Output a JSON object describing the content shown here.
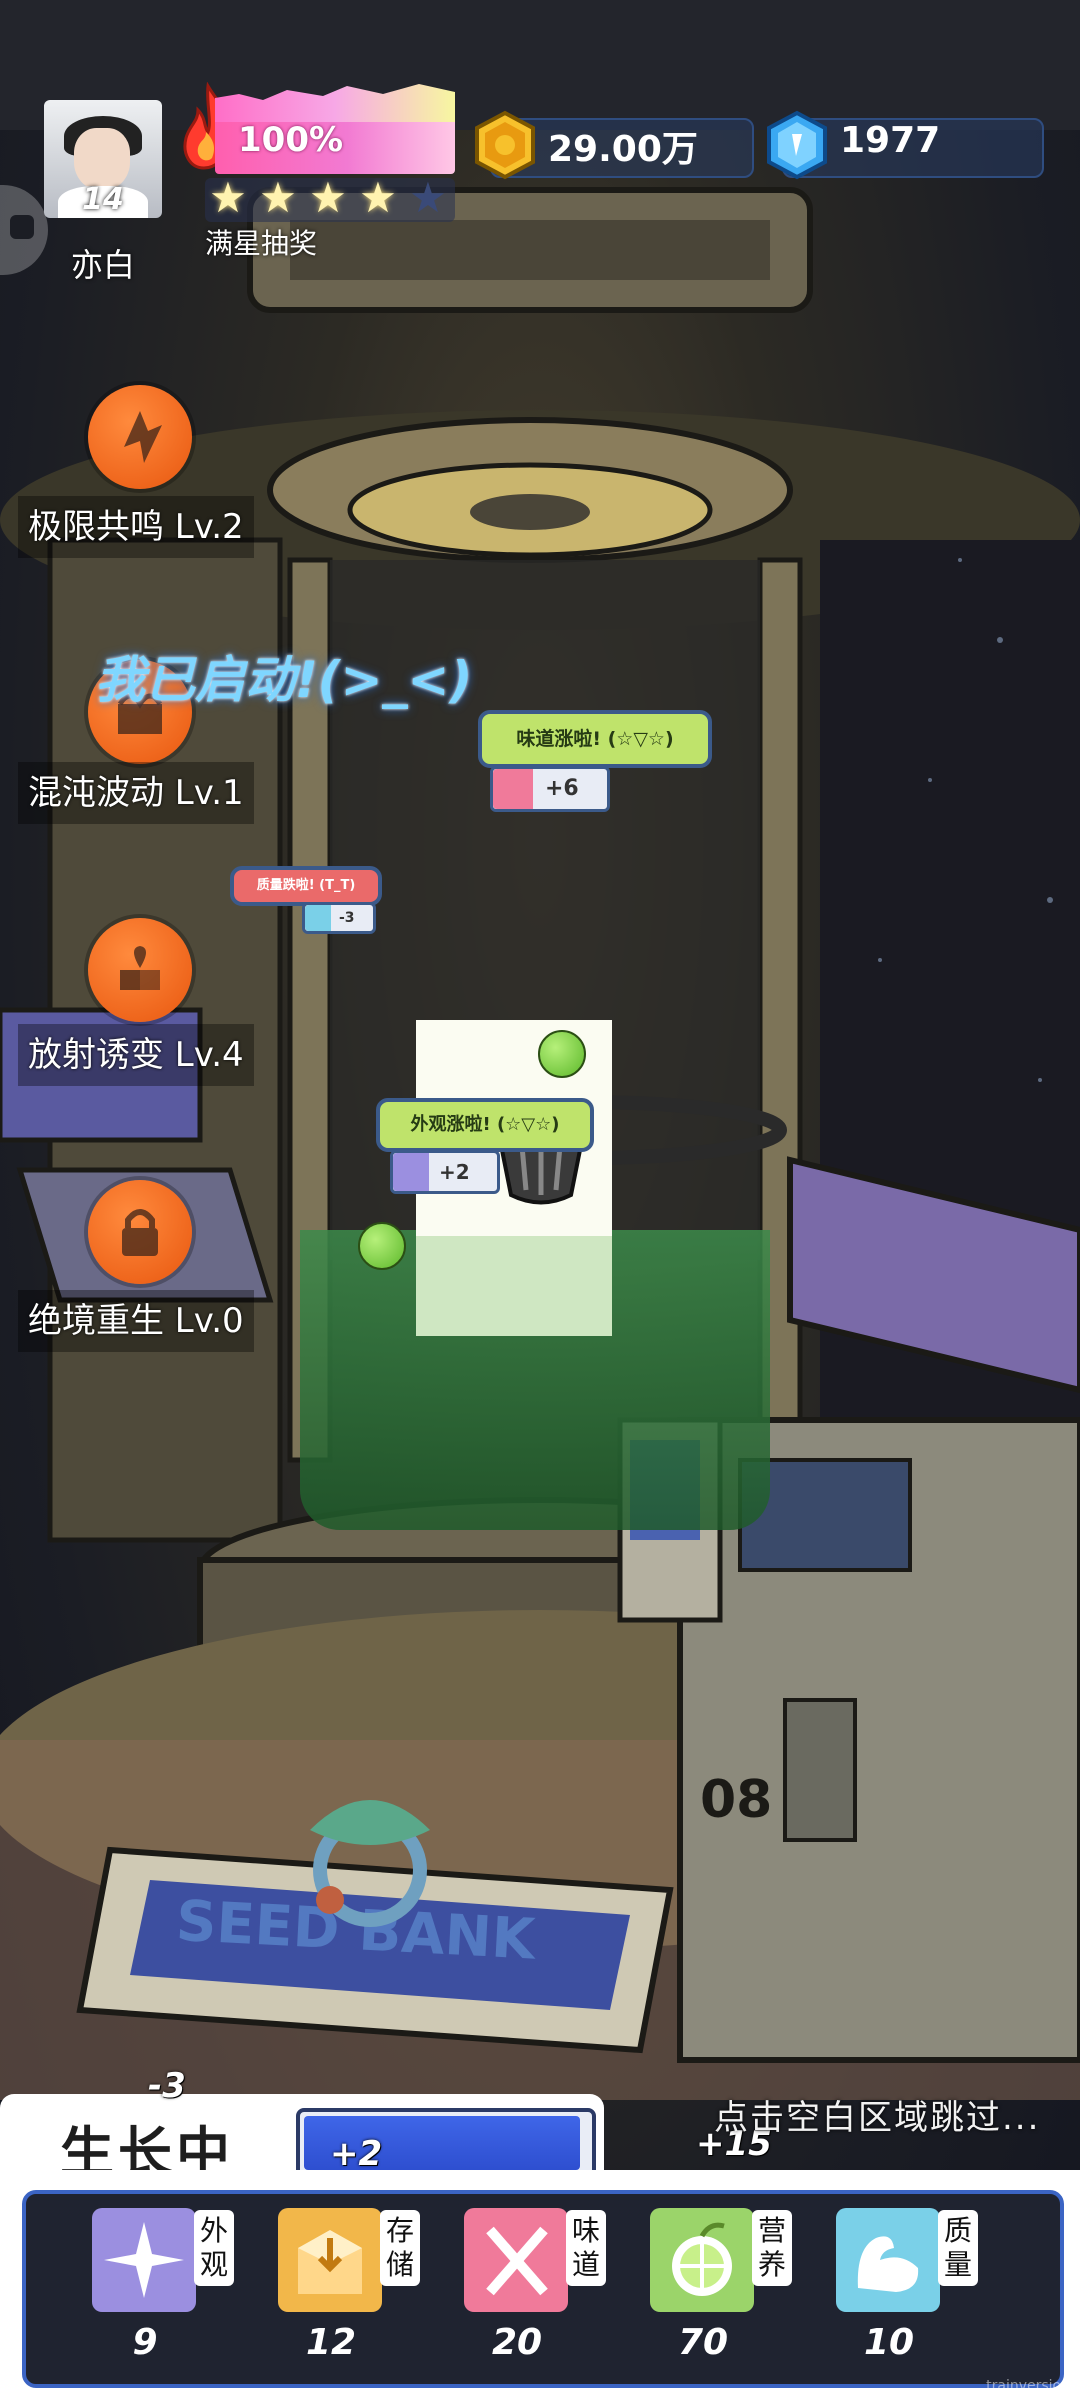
{
  "player": {
    "name": "亦白",
    "level": "14",
    "avatar_icon": "player-portrait"
  },
  "energy": {
    "percent_label": "100%",
    "fill": 1.0,
    "stars_filled": 4,
    "stars_total": 5,
    "lottery_label": "满星抽奖"
  },
  "currency": {
    "coins": "29.00万",
    "coin_icon": "gold-coin-icon",
    "gems": "1977",
    "gem_icon": "blue-gem-icon"
  },
  "skills": [
    {
      "label": "极限共鸣 Lv.2",
      "icon": "resonance-icon"
    },
    {
      "label": "混沌波动 Lv.1",
      "icon": "chaos-wave-icon"
    },
    {
      "label": "放射诱变 Lv.4",
      "icon": "mutation-icon"
    },
    {
      "label": "绝境重生 Lv.0",
      "icon": "lock-icon"
    }
  ],
  "banner": "我已启动!(>_<)",
  "popups": {
    "taste": {
      "text": "味道涨啦! (☆▽☆)",
      "delta": "+6"
    },
    "quality": {
      "text": "质量跌啦! (T_T)",
      "delta": "-3"
    },
    "appearance": {
      "text": "外观涨啦! (☆▽☆)",
      "delta": "+2"
    }
  },
  "scene": {
    "machine_number": "08"
  },
  "growth": {
    "status": "生长中",
    "progress_fill": 1.0,
    "float_left": "-3",
    "float_bar": "+2",
    "float_right": "+15",
    "skip_hint": "点击空白区域跳过..."
  },
  "stats": [
    {
      "tag": "外观",
      "value": "9",
      "color": "#9b8fe0",
      "icon": "sparkle-icon"
    },
    {
      "tag": "存储",
      "value": "12",
      "color": "#f2b74a",
      "icon": "box-icon"
    },
    {
      "tag": "味道",
      "value": "20",
      "color": "#f07a9a",
      "icon": "utensils-icon"
    },
    {
      "tag": "营养",
      "value": "70",
      "color": "#9bd46a",
      "icon": "citrus-icon"
    },
    {
      "tag": "质量",
      "value": "10",
      "color": "#7ad0e8",
      "icon": "muscle-icon"
    }
  ],
  "watermark": "trainversion"
}
